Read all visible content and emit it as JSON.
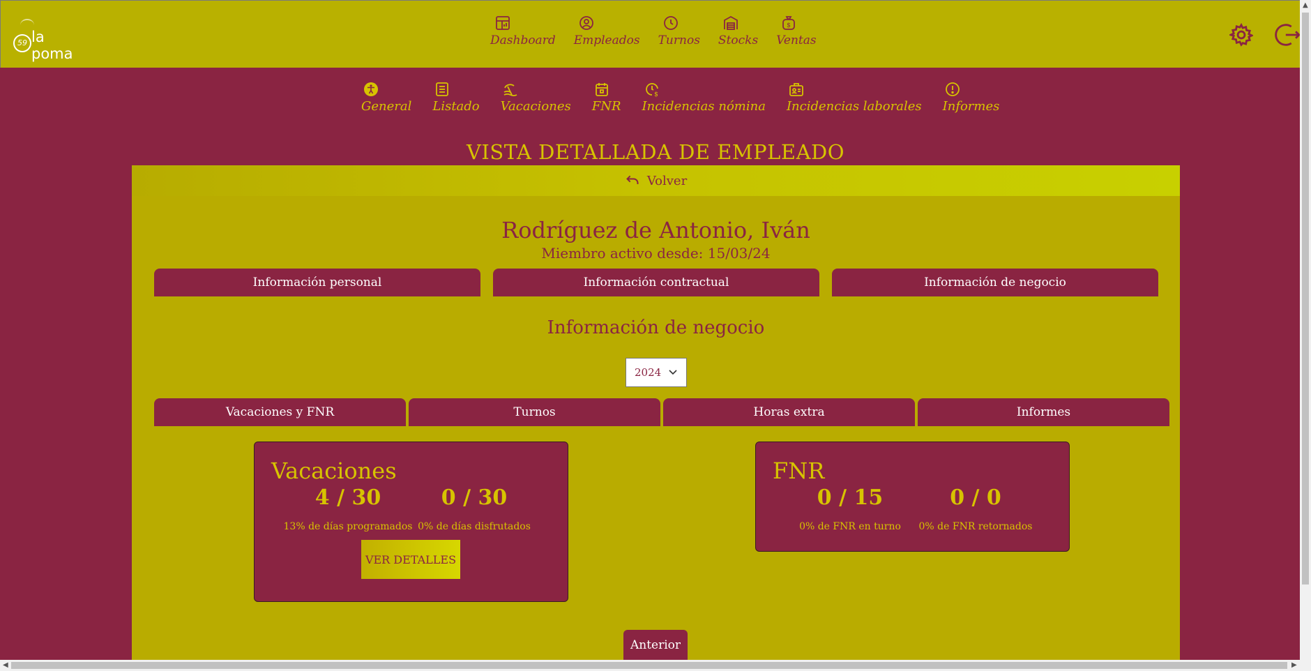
{
  "brand": {
    "logo_text": "la poma",
    "logo_badge": "59"
  },
  "topnav": [
    {
      "label": "Dashboard",
      "icon": "dashboard-icon"
    },
    {
      "label": "Empleados",
      "icon": "user-circle-icon"
    },
    {
      "label": "Turnos",
      "icon": "clock-icon"
    },
    {
      "label": "Stocks",
      "icon": "warehouse-icon"
    },
    {
      "label": "Ventas",
      "icon": "money-bag-icon"
    }
  ],
  "subnav": [
    {
      "label": "General",
      "icon": "accessibility-icon"
    },
    {
      "label": "Listado",
      "icon": "list-icon"
    },
    {
      "label": "Vacaciones",
      "icon": "beach-icon"
    },
    {
      "label": "FNR",
      "icon": "calendar-icon"
    },
    {
      "label": "Incidencias nómina",
      "icon": "clock-dollar-icon"
    },
    {
      "label": "Incidencias laborales",
      "icon": "id-badge-icon"
    },
    {
      "label": "Informes",
      "icon": "alert-circle-icon"
    }
  ],
  "page": {
    "title": "VISTA DETALLADA DE EMPLEADO",
    "back_label": "Volver",
    "employee_name": "Rodríguez de Antonio, Iván",
    "member_since": "Miembro activo desde: 15/03/24",
    "info_tabs": [
      "Información personal",
      "Información contractual",
      "Información de negocio"
    ],
    "section_title": "Información de negocio",
    "year": "2024",
    "business_tabs": [
      "Vacaciones y FNR",
      "Turnos",
      "Horas extra",
      "Informes"
    ],
    "vacaciones": {
      "title": "Vacaciones",
      "stat1_value": "4 / 30",
      "stat1_label": "13% de días programados",
      "stat2_value": "0 / 30",
      "stat2_label": "0% de días disfrutados",
      "details_label": "VER DETALLES"
    },
    "fnr": {
      "title": "FNR",
      "stat1_value": "0 / 15",
      "stat1_label": "0% de FNR en turno",
      "stat2_value": "0 / 0",
      "stat2_label": "0% de FNR retornados"
    },
    "prev_label": "Anterior"
  },
  "colors": {
    "primary": "#8a2442",
    "accent": "#b9b100",
    "highlight": "#d7c300"
  }
}
